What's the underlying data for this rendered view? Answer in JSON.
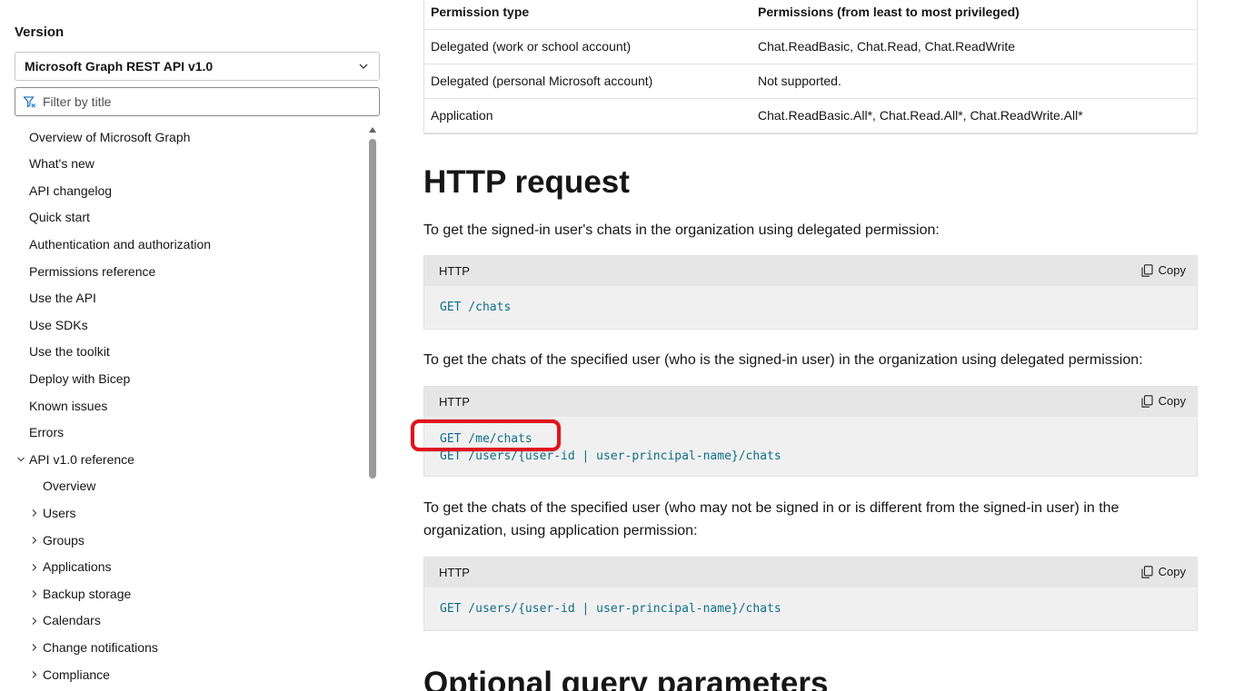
{
  "sidebar": {
    "version_label": "Version",
    "version_selected": "Microsoft Graph REST API v1.0",
    "filter_placeholder": "Filter by title",
    "items": [
      {
        "label": "Overview of Microsoft Graph",
        "indent": 0,
        "expander": "none"
      },
      {
        "label": "What's new",
        "indent": 0,
        "expander": "none"
      },
      {
        "label": "API changelog",
        "indent": 0,
        "expander": "none"
      },
      {
        "label": "Quick start",
        "indent": 0,
        "expander": "none"
      },
      {
        "label": "Authentication and authorization",
        "indent": 0,
        "expander": "none"
      },
      {
        "label": "Permissions reference",
        "indent": 0,
        "expander": "none"
      },
      {
        "label": "Use the API",
        "indent": 0,
        "expander": "none"
      },
      {
        "label": "Use SDKs",
        "indent": 0,
        "expander": "none"
      },
      {
        "label": "Use the toolkit",
        "indent": 0,
        "expander": "none"
      },
      {
        "label": "Deploy with Bicep",
        "indent": 0,
        "expander": "none"
      },
      {
        "label": "Known issues",
        "indent": 0,
        "expander": "none"
      },
      {
        "label": "Errors",
        "indent": 0,
        "expander": "none"
      },
      {
        "label": "API v1.0 reference",
        "indent": 0,
        "expander": "expanded"
      },
      {
        "label": "Overview",
        "indent": 1,
        "expander": "none"
      },
      {
        "label": "Users",
        "indent": 1,
        "expander": "collapsed"
      },
      {
        "label": "Groups",
        "indent": 1,
        "expander": "collapsed"
      },
      {
        "label": "Applications",
        "indent": 1,
        "expander": "collapsed"
      },
      {
        "label": "Backup storage",
        "indent": 1,
        "expander": "collapsed"
      },
      {
        "label": "Calendars",
        "indent": 1,
        "expander": "collapsed"
      },
      {
        "label": "Change notifications",
        "indent": 1,
        "expander": "collapsed"
      },
      {
        "label": "Compliance",
        "indent": 1,
        "expander": "collapsed"
      }
    ]
  },
  "permissions_table": {
    "headers": [
      "Permission type",
      "Permissions (from least to most privileged)"
    ],
    "rows": [
      [
        "Delegated (work or school account)",
        "Chat.ReadBasic, Chat.Read, Chat.ReadWrite"
      ],
      [
        "Delegated (personal Microsoft account)",
        "Not supported."
      ],
      [
        "Application",
        "Chat.ReadBasic.All*, Chat.Read.All*, Chat.ReadWrite.All*"
      ]
    ]
  },
  "http_request": {
    "heading": "HTTP request",
    "para1": "To get the signed-in user's chats in the organization using delegated permission:",
    "para2": "To get the chats of the specified user (who is the signed-in user) in the organization using delegated permission:",
    "para3_line1": "To get the chats of the specified user (who may not be signed in or is different from the signed-in user) in the",
    "para3_line2": "organization, using application permission:",
    "blocks": [
      {
        "lang": "HTTP",
        "copy_label": "Copy",
        "lines": [
          "GET /chats"
        ]
      },
      {
        "lang": "HTTP",
        "copy_label": "Copy",
        "lines": [
          "GET /me/chats",
          "GET /users/{user-id | user-principal-name}/chats"
        ]
      },
      {
        "lang": "HTTP",
        "copy_label": "Copy",
        "lines": [
          "GET /users/{user-id | user-principal-name}/chats"
        ]
      }
    ]
  },
  "next_heading": "Optional query parameters",
  "colors": {
    "code_text": "#0e6d88",
    "highlight": "#e0141e",
    "code_bg": "#f0f0f0",
    "code_header_bg": "#e6e6e6"
  }
}
